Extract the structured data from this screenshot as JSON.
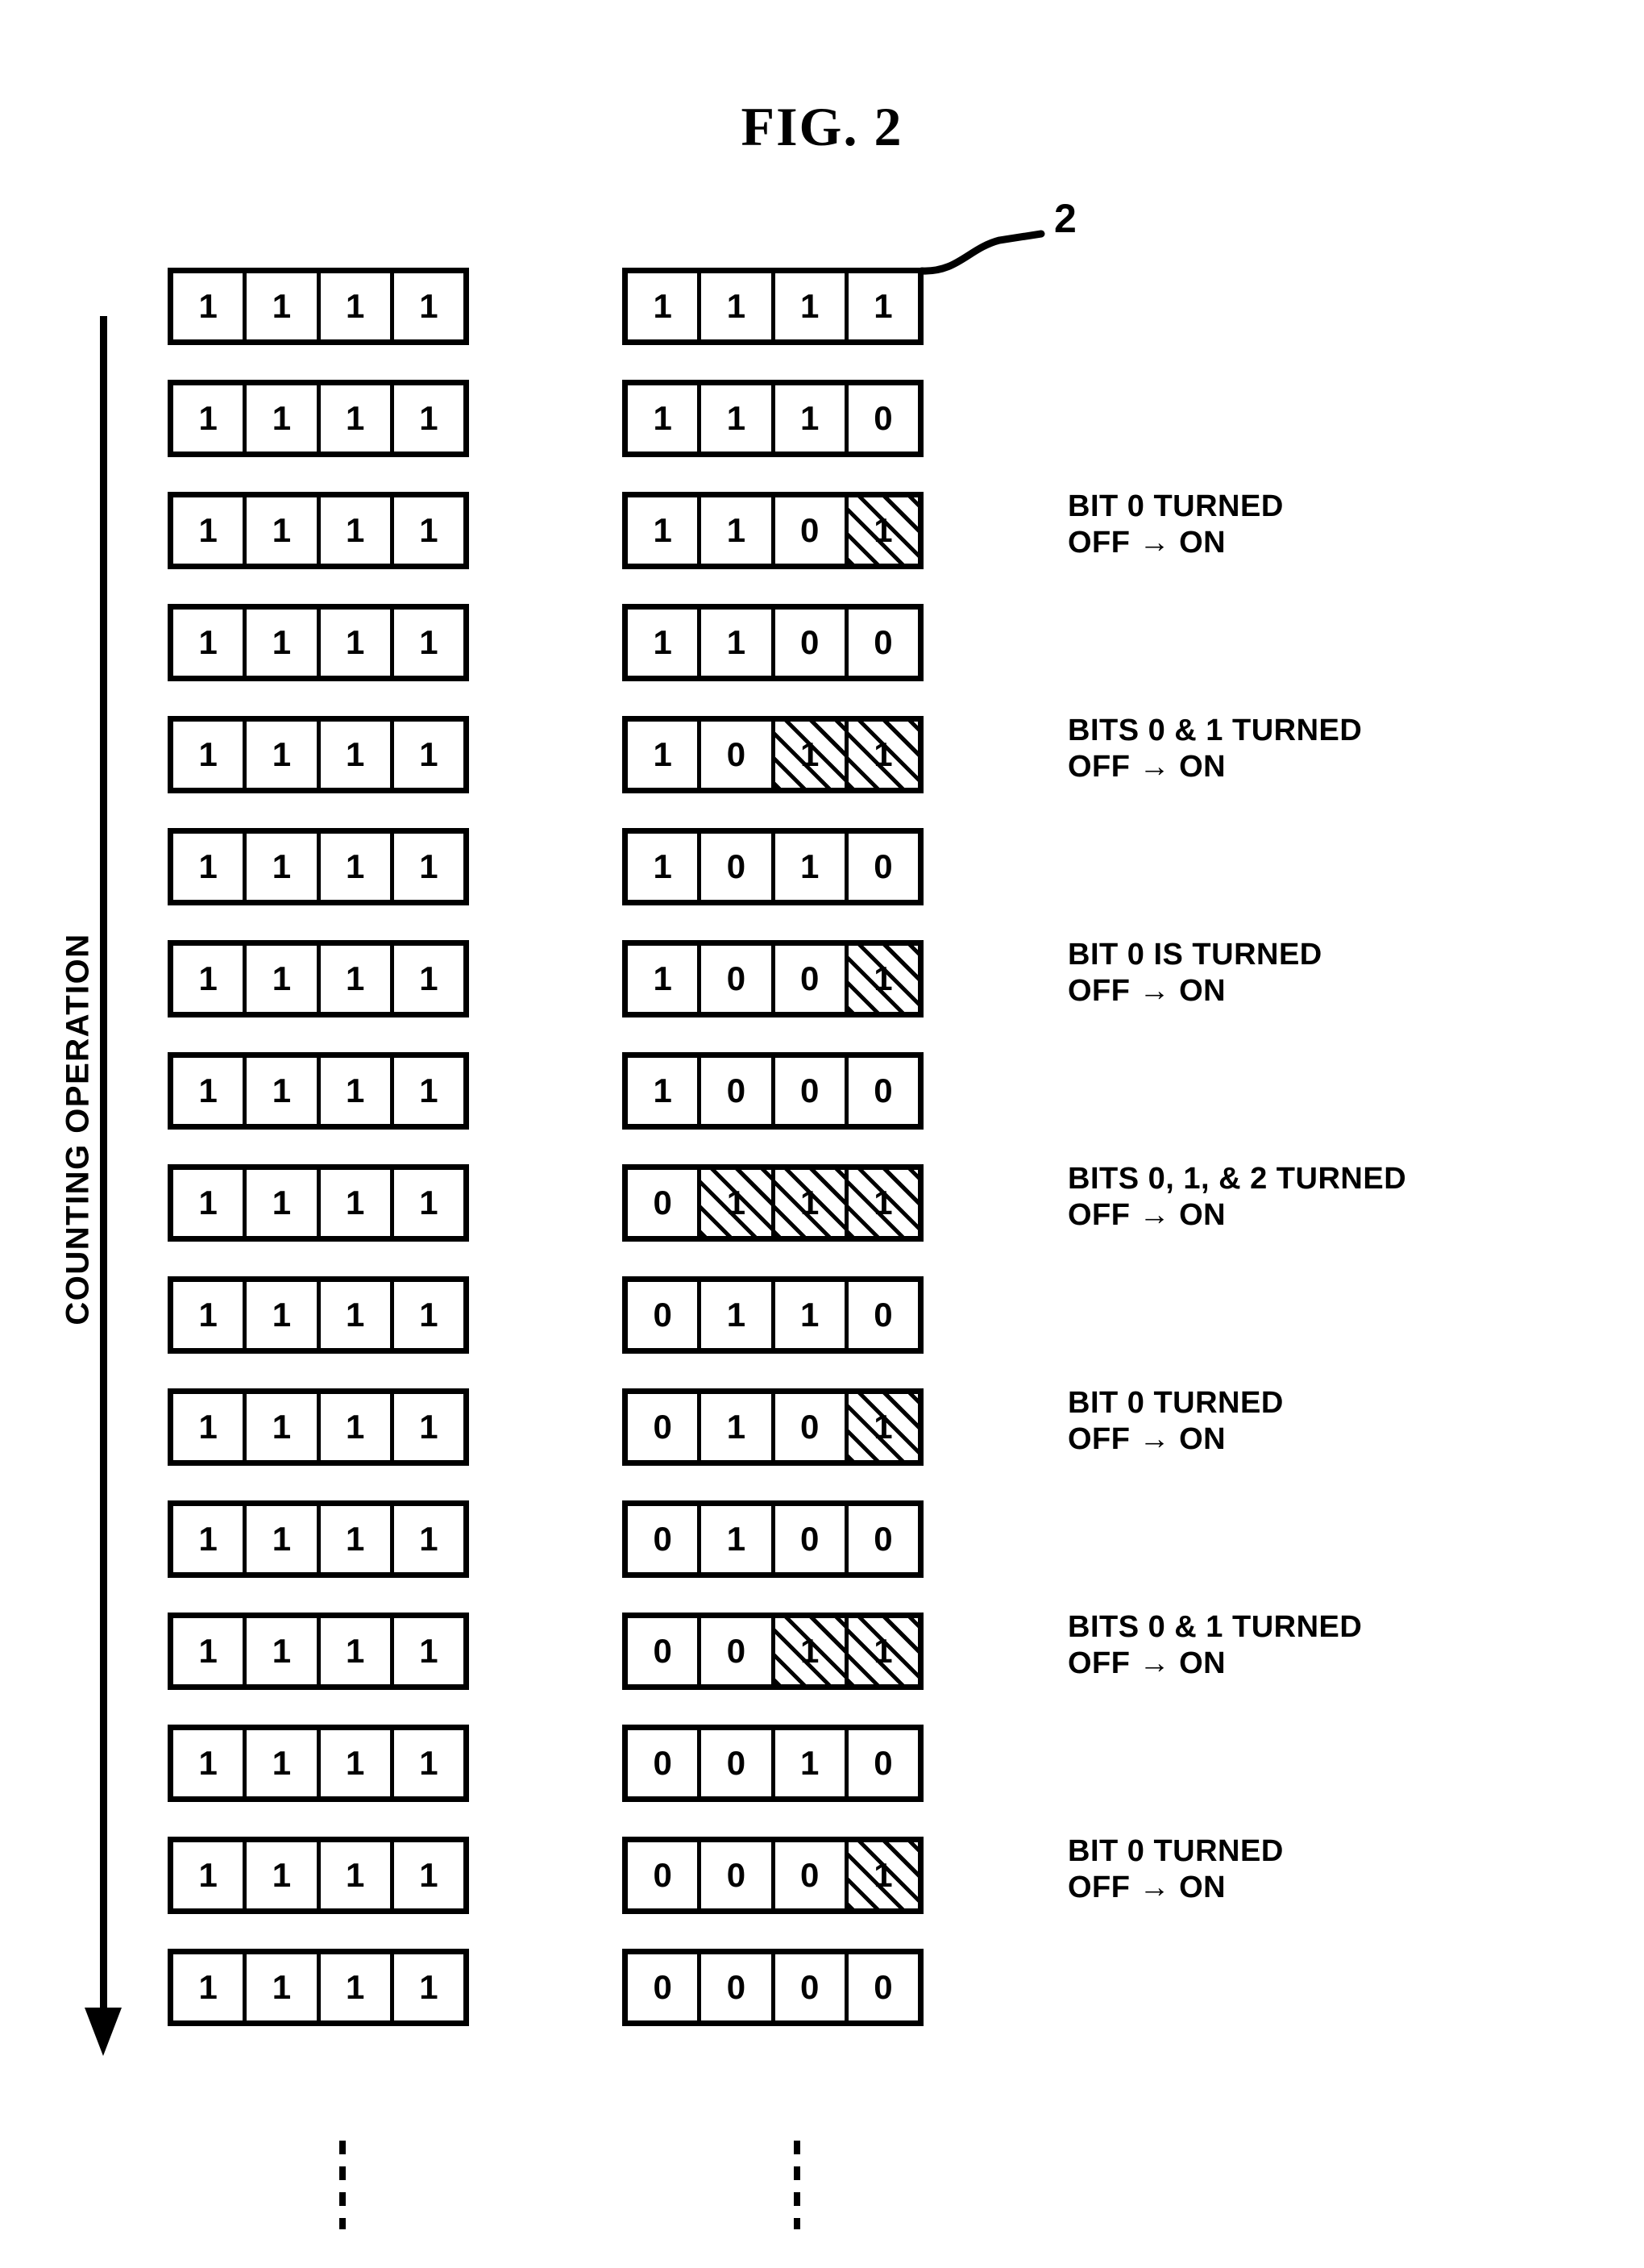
{
  "figure": {
    "title": "FIG. 2",
    "reference_numeral": "2",
    "axis_label": "COUNTING OPERATION",
    "bits_per_group": 4,
    "groups": [
      "left",
      "right"
    ]
  },
  "rows": [
    {
      "index": 0,
      "left": {
        "digits": [
          "1",
          "1",
          "1",
          "1"
        ],
        "hatched": [
          false,
          false,
          false,
          false
        ]
      },
      "right": {
        "digits": [
          "1",
          "1",
          "1",
          "1"
        ],
        "hatched": [
          false,
          false,
          false,
          false
        ]
      },
      "annotation": null
    },
    {
      "index": 1,
      "left": {
        "digits": [
          "1",
          "1",
          "1",
          "1"
        ],
        "hatched": [
          false,
          false,
          false,
          false
        ]
      },
      "right": {
        "digits": [
          "1",
          "1",
          "1",
          "0"
        ],
        "hatched": [
          false,
          false,
          false,
          false
        ]
      },
      "annotation": null
    },
    {
      "index": 2,
      "left": {
        "digits": [
          "1",
          "1",
          "1",
          "1"
        ],
        "hatched": [
          false,
          false,
          false,
          false
        ]
      },
      "right": {
        "digits": [
          "1",
          "1",
          "0",
          "1"
        ],
        "hatched": [
          false,
          false,
          false,
          true
        ]
      },
      "annotation": {
        "line1": "BIT 0 TURNED",
        "line2": "OFF → ON"
      }
    },
    {
      "index": 3,
      "left": {
        "digits": [
          "1",
          "1",
          "1",
          "1"
        ],
        "hatched": [
          false,
          false,
          false,
          false
        ]
      },
      "right": {
        "digits": [
          "1",
          "1",
          "0",
          "0"
        ],
        "hatched": [
          false,
          false,
          false,
          false
        ]
      },
      "annotation": null
    },
    {
      "index": 4,
      "left": {
        "digits": [
          "1",
          "1",
          "1",
          "1"
        ],
        "hatched": [
          false,
          false,
          false,
          false
        ]
      },
      "right": {
        "digits": [
          "1",
          "0",
          "1",
          "1"
        ],
        "hatched": [
          false,
          false,
          true,
          true
        ]
      },
      "annotation": {
        "line1": "BITS 0 & 1 TURNED",
        "line2": "OFF → ON"
      }
    },
    {
      "index": 5,
      "left": {
        "digits": [
          "1",
          "1",
          "1",
          "1"
        ],
        "hatched": [
          false,
          false,
          false,
          false
        ]
      },
      "right": {
        "digits": [
          "1",
          "0",
          "1",
          "0"
        ],
        "hatched": [
          false,
          false,
          false,
          false
        ]
      },
      "annotation": null
    },
    {
      "index": 6,
      "left": {
        "digits": [
          "1",
          "1",
          "1",
          "1"
        ],
        "hatched": [
          false,
          false,
          false,
          false
        ]
      },
      "right": {
        "digits": [
          "1",
          "0",
          "0",
          "1"
        ],
        "hatched": [
          false,
          false,
          false,
          true
        ]
      },
      "annotation": {
        "line1": "BIT 0 IS TURNED",
        "line2": "OFF → ON"
      }
    },
    {
      "index": 7,
      "left": {
        "digits": [
          "1",
          "1",
          "1",
          "1"
        ],
        "hatched": [
          false,
          false,
          false,
          false
        ]
      },
      "right": {
        "digits": [
          "1",
          "0",
          "0",
          "0"
        ],
        "hatched": [
          false,
          false,
          false,
          false
        ]
      },
      "annotation": null
    },
    {
      "index": 8,
      "left": {
        "digits": [
          "1",
          "1",
          "1",
          "1"
        ],
        "hatched": [
          false,
          false,
          false,
          false
        ]
      },
      "right": {
        "digits": [
          "0",
          "1",
          "1",
          "1"
        ],
        "hatched": [
          false,
          true,
          true,
          true
        ]
      },
      "annotation": {
        "line1": "BITS 0, 1, & 2 TURNED",
        "line2": "OFF → ON"
      }
    },
    {
      "index": 9,
      "left": {
        "digits": [
          "1",
          "1",
          "1",
          "1"
        ],
        "hatched": [
          false,
          false,
          false,
          false
        ]
      },
      "right": {
        "digits": [
          "0",
          "1",
          "1",
          "0"
        ],
        "hatched": [
          false,
          false,
          false,
          false
        ]
      },
      "annotation": null
    },
    {
      "index": 10,
      "left": {
        "digits": [
          "1",
          "1",
          "1",
          "1"
        ],
        "hatched": [
          false,
          false,
          false,
          false
        ]
      },
      "right": {
        "digits": [
          "0",
          "1",
          "0",
          "1"
        ],
        "hatched": [
          false,
          false,
          false,
          true
        ]
      },
      "annotation": {
        "line1": "BIT 0 TURNED",
        "line2": "OFF → ON"
      }
    },
    {
      "index": 11,
      "left": {
        "digits": [
          "1",
          "1",
          "1",
          "1"
        ],
        "hatched": [
          false,
          false,
          false,
          false
        ]
      },
      "right": {
        "digits": [
          "0",
          "1",
          "0",
          "0"
        ],
        "hatched": [
          false,
          false,
          false,
          false
        ]
      },
      "annotation": null
    },
    {
      "index": 12,
      "left": {
        "digits": [
          "1",
          "1",
          "1",
          "1"
        ],
        "hatched": [
          false,
          false,
          false,
          false
        ]
      },
      "right": {
        "digits": [
          "0",
          "0",
          "1",
          "1"
        ],
        "hatched": [
          false,
          false,
          true,
          true
        ]
      },
      "annotation": {
        "line1": "BITS 0 & 1 TURNED",
        "line2": "OFF → ON"
      }
    },
    {
      "index": 13,
      "left": {
        "digits": [
          "1",
          "1",
          "1",
          "1"
        ],
        "hatched": [
          false,
          false,
          false,
          false
        ]
      },
      "right": {
        "digits": [
          "0",
          "0",
          "1",
          "0"
        ],
        "hatched": [
          false,
          false,
          false,
          false
        ]
      },
      "annotation": null
    },
    {
      "index": 14,
      "left": {
        "digits": [
          "1",
          "1",
          "1",
          "1"
        ],
        "hatched": [
          false,
          false,
          false,
          false
        ]
      },
      "right": {
        "digits": [
          "0",
          "0",
          "0",
          "1"
        ],
        "hatched": [
          false,
          false,
          false,
          true
        ]
      },
      "annotation": {
        "line1": "BIT 0 TURNED",
        "line2": "OFF → ON"
      }
    },
    {
      "index": 15,
      "left": {
        "digits": [
          "1",
          "1",
          "1",
          "1"
        ],
        "hatched": [
          false,
          false,
          false,
          false
        ]
      },
      "right": {
        "digits": [
          "0",
          "0",
          "0",
          "0"
        ],
        "hatched": [
          false,
          false,
          false,
          false
        ]
      },
      "annotation": null
    }
  ],
  "colors": {
    "ink": "#000000",
    "paper": "#ffffff"
  }
}
